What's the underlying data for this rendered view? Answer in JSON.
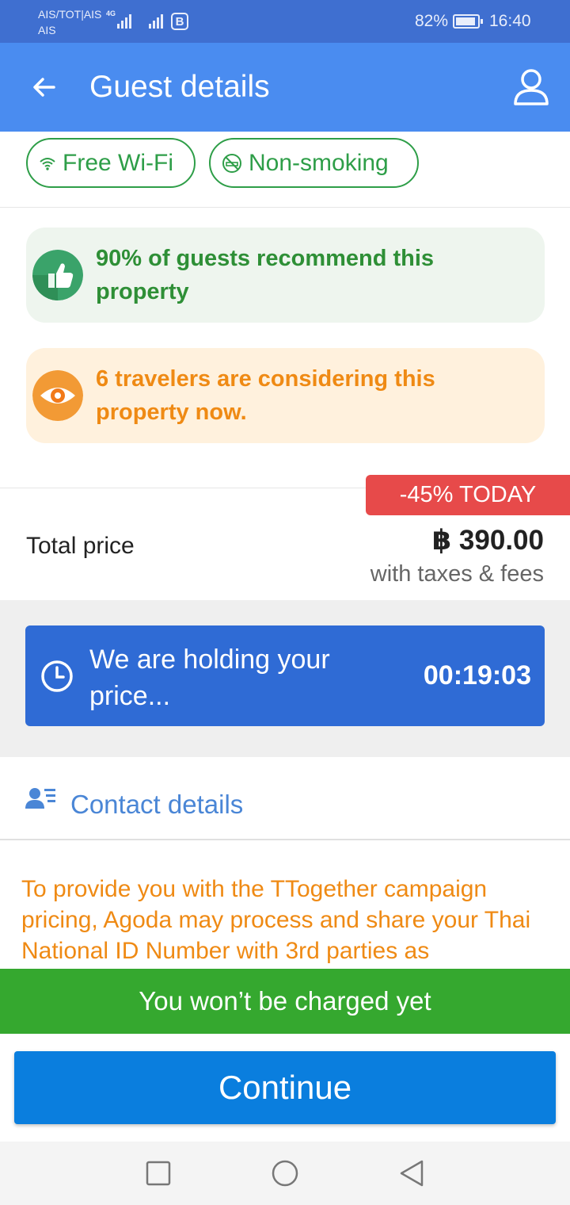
{
  "status_bar": {
    "carrier_line1": "AIS/TOT|AIS",
    "carrier_line2": "AIS",
    "network_type": "4G",
    "badge": "B",
    "battery": "82%",
    "time": "16:40"
  },
  "app_bar": {
    "title": "Guest details",
    "back_icon": "arrow-left-icon",
    "profile_icon": "user-icon"
  },
  "amenities": [
    {
      "label": "Free Wi-Fi",
      "icon": "wifi-icon"
    },
    {
      "label": "Non-smoking",
      "icon": "no-smoking-icon"
    }
  ],
  "banners": {
    "recommend": {
      "text": "90% of guests recommend this property",
      "icon": "thumbs-up-icon",
      "color": "#2e8f36"
    },
    "viewers": {
      "text": "6 travelers are considering this property now.",
      "icon": "eye-icon",
      "color": "#ef8a14"
    }
  },
  "price": {
    "discount_badge": "-45% TODAY",
    "total_label": "Total price",
    "amount": "฿ 390.00",
    "subtext": "with taxes & fees"
  },
  "hold": {
    "text": "We are holding your price...",
    "timer": "00:19:03",
    "icon": "clock-icon"
  },
  "contact": {
    "title": "Contact details",
    "icon": "contact-card-icon",
    "notice": "To provide you with the TTogether campaign pricing, Agoda may process and share your Thai National ID Number with 3rd parties as"
  },
  "bottom": {
    "charge_note": "You won’t be charged yet",
    "continue_label": "Continue"
  },
  "nav": {
    "recents": "square-icon",
    "home": "circle-icon",
    "back": "triangle-back-icon"
  },
  "colors": {
    "status_bar": "#3f6fd0",
    "app_bar": "#4a8cf0",
    "accent_green": "#35a82f",
    "discount_red": "#e74a4a",
    "continue_blue": "#0a7ede"
  }
}
